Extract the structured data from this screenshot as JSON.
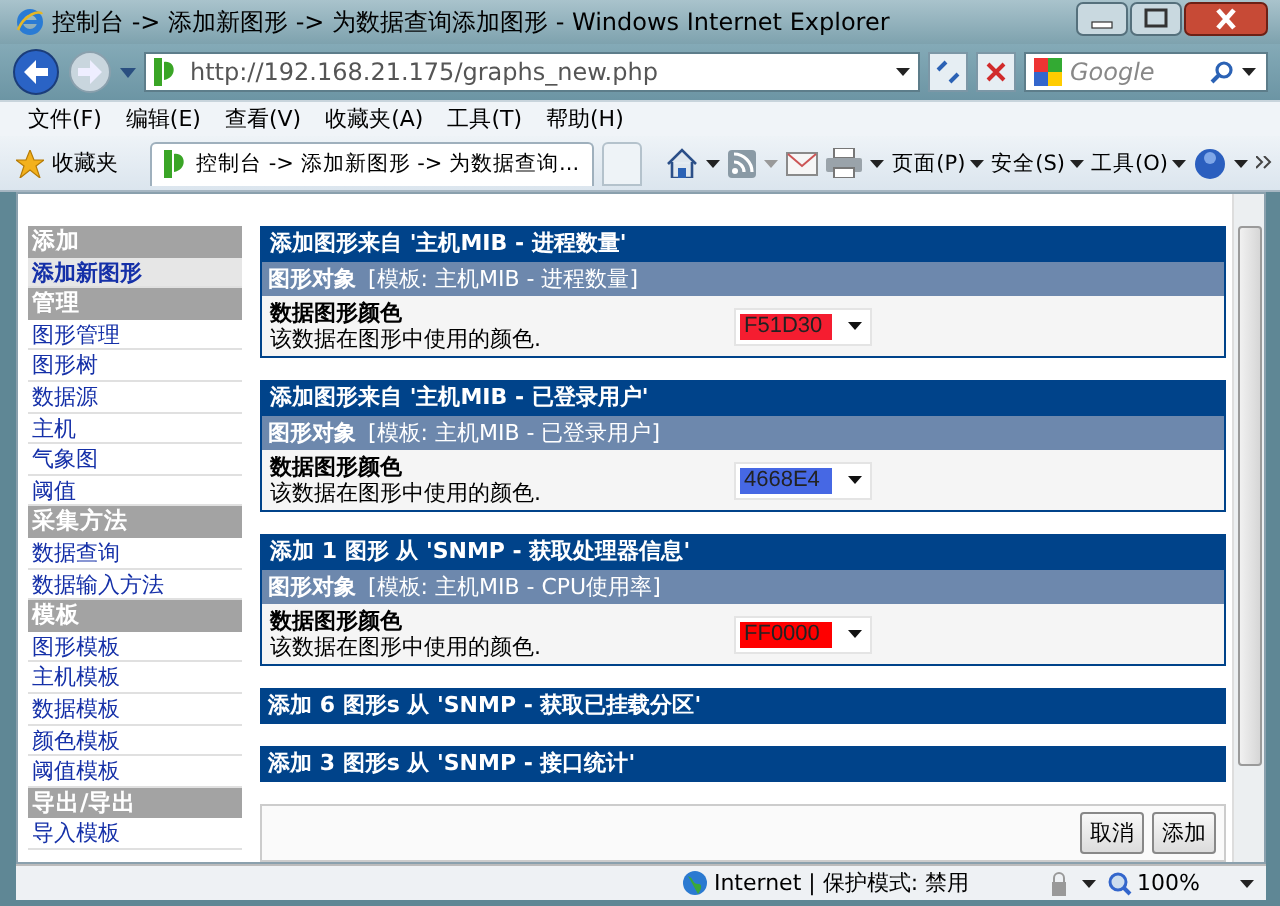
{
  "window": {
    "title": "控制台 -> 添加新图形 -> 为数据查询添加图形 - Windows Internet Explorer"
  },
  "address_bar": {
    "url": "http://192.168.21.175/graphs_new.php"
  },
  "search": {
    "placeholder": "Google"
  },
  "menu": [
    "文件(F)",
    "编辑(E)",
    "查看(V)",
    "收藏夹(A)",
    "工具(T)",
    "帮助(H)"
  ],
  "favorites": {
    "label": "收藏夹"
  },
  "tabs": [
    {
      "label": "控制台 -> 添加新图形 -> 为数据查询...",
      "selected": true
    }
  ],
  "toolbar": [
    "页面(P)",
    "安全(S)",
    "工具(O)"
  ],
  "sidebar": {
    "items": [
      {
        "kind": "header",
        "label": "添加"
      },
      {
        "kind": "link",
        "label": "添加新图形",
        "selected": true
      },
      {
        "kind": "header",
        "label": "管理"
      },
      {
        "kind": "link",
        "label": "图形管理",
        "selected": false
      },
      {
        "kind": "link",
        "label": "图形树",
        "selected": false
      },
      {
        "kind": "link",
        "label": "数据源",
        "selected": false
      },
      {
        "kind": "link",
        "label": "主机",
        "selected": false
      },
      {
        "kind": "link",
        "label": "气象图",
        "selected": false
      },
      {
        "kind": "link",
        "label": "阈值",
        "selected": false
      },
      {
        "kind": "header",
        "label": "采集方法"
      },
      {
        "kind": "link",
        "label": "数据查询",
        "selected": false
      },
      {
        "kind": "link",
        "label": "数据输入方法",
        "selected": false
      },
      {
        "kind": "header",
        "label": "模板"
      },
      {
        "kind": "link",
        "label": "图形模板",
        "selected": false
      },
      {
        "kind": "link",
        "label": "主机模板",
        "selected": false
      },
      {
        "kind": "link",
        "label": "数据模板",
        "selected": false
      },
      {
        "kind": "link",
        "label": "颜色模板",
        "selected": false
      },
      {
        "kind": "link",
        "label": "阈值模板",
        "selected": false
      },
      {
        "kind": "header",
        "label": "导出/导出"
      },
      {
        "kind": "link",
        "label": "导入模板",
        "selected": false
      }
    ]
  },
  "cards": [
    {
      "kind": "expanded",
      "title": "添加图形来自 '主机MIB - 进程数量'",
      "object_label": "图形对象",
      "template": "[模板: 主机MIB - 进程数量]",
      "field_label": "数据图形颜色",
      "field_hint": "该数据在图形中使用的颜色.",
      "value": "F51D30",
      "color": "#f51d30"
    },
    {
      "kind": "expanded",
      "title": "添加图形来自 '主机MIB - 已登录用户'",
      "object_label": "图形对象",
      "template": "[模板: 主机MIB - 已登录用户]",
      "field_label": "数据图形颜色",
      "field_hint": "该数据在图形中使用的颜色.",
      "value": "4668E4",
      "color": "#4668e4"
    },
    {
      "kind": "expanded",
      "title": "添加 1 图形 从 'SNMP - 获取处理器信息'",
      "object_label": "图形对象",
      "template": "[模板: 主机MIB - CPU使用率]",
      "field_label": "数据图形颜色",
      "field_hint": "该数据在图形中使用的颜色.",
      "value": "FF0000",
      "color": "#ff0000"
    },
    {
      "kind": "collapsed",
      "title": "添加 6 图形s 从 'SNMP - 获取已挂载分区'"
    },
    {
      "kind": "collapsed",
      "title": "添加 3 图形s 从 'SNMP - 接口统计'"
    }
  ],
  "buttons": [
    "取消",
    "添加"
  ],
  "status_bar": {
    "zone": "Internet | 保护模式: 禁用",
    "zoom": "100%"
  }
}
